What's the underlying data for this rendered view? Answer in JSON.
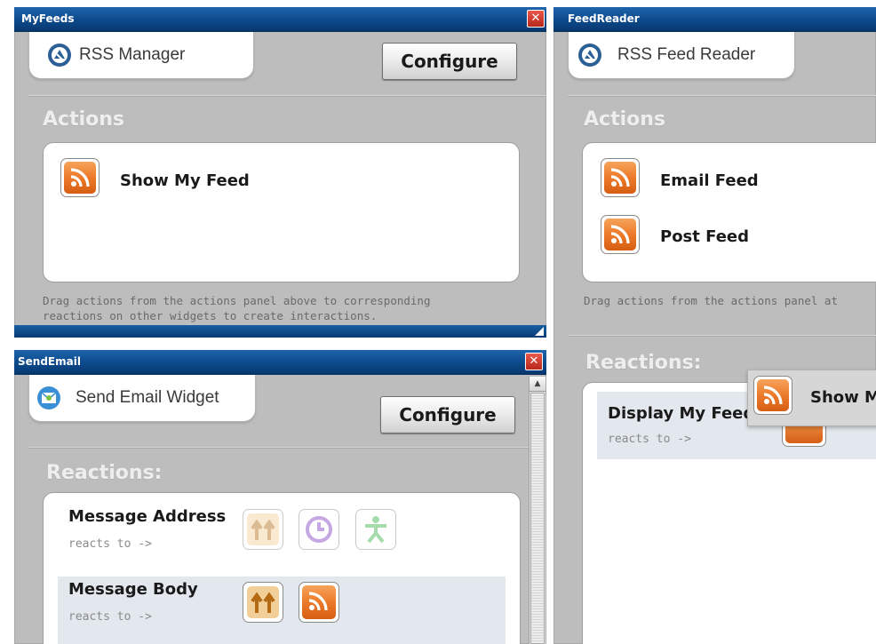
{
  "myfeeds": {
    "title": "MyFeeds",
    "header": "RSS Manager",
    "configure_label": "Configure",
    "actions_heading": "Actions",
    "actions": [
      {
        "label": "Show My Feed",
        "icon": "rss-icon"
      }
    ],
    "hint_line1": "Drag actions from the actions panel above to corresponding",
    "hint_line2": "reactions on other widgets to create interactions."
  },
  "feedreader": {
    "title": "FeedReader",
    "header": "RSS Feed Reader",
    "actions_heading": "Actions",
    "actions": [
      {
        "label": "Email Feed",
        "icon": "rss-icon"
      },
      {
        "label": "Post Feed",
        "icon": "rss-icon"
      }
    ],
    "hint_line1": "Drag actions from the actions panel at",
    "reactions_heading": "Reactions:",
    "reactions": [
      {
        "label": "Display My Feed",
        "reacts": "reacts to ->"
      }
    ],
    "drag_ghost_label": "Show M"
  },
  "sendemail": {
    "title": "SendEmail",
    "header": "Send Email Widget",
    "configure_label": "Configure",
    "reactions_heading": "Reactions:",
    "reactions": [
      {
        "label": "Message Address",
        "reacts": "reacts to ->",
        "icons": [
          "arrows-up-icon",
          "clock-icon",
          "person-icon"
        ]
      },
      {
        "label": "Message Body",
        "reacts": "reacts to ->",
        "icons": [
          "arrows-up-icon",
          "rss-icon"
        ]
      }
    ]
  },
  "colors": {
    "titlebar": "#0d4a8c",
    "close": "#c8372b",
    "widget_bg": "#bdbdbd",
    "rss_orange": "#ec7a2a",
    "reaction_row_bg": "#e3e8ee"
  }
}
